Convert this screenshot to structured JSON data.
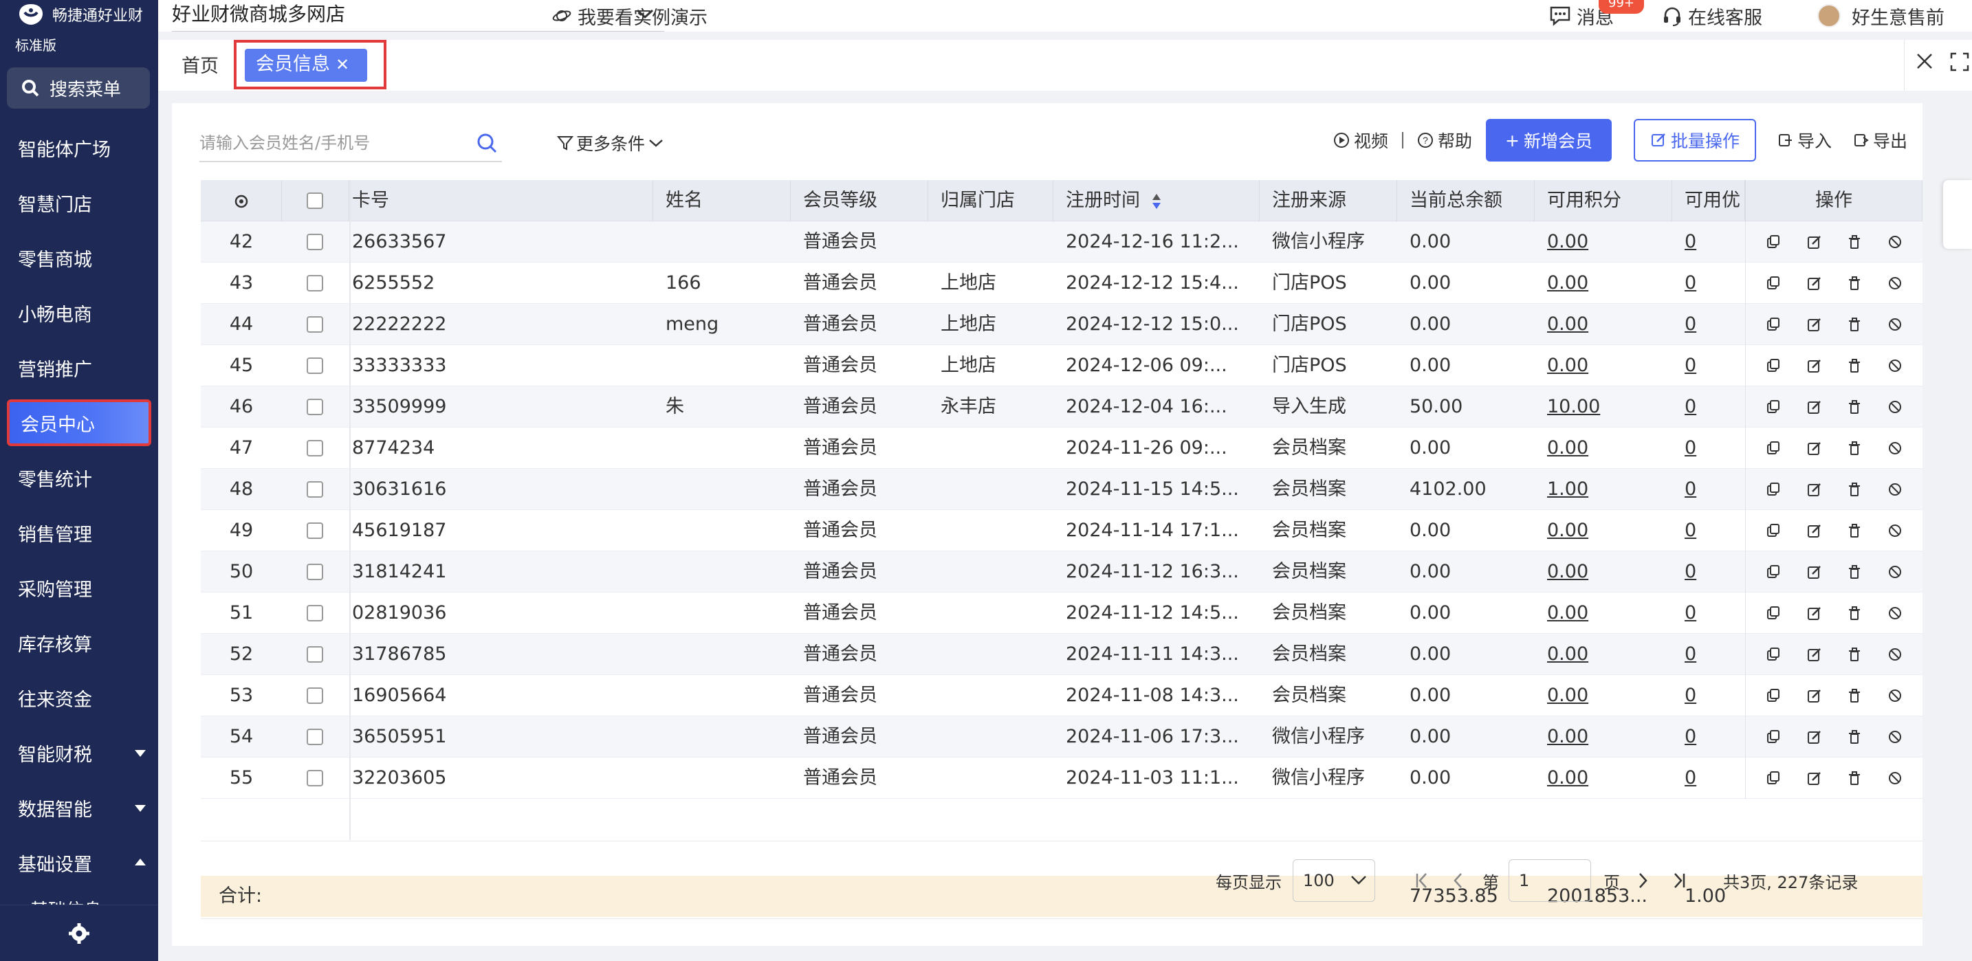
{
  "app": {
    "brand": "畅捷通好业财",
    "edition": "标准版",
    "search_menu": "搜索菜单"
  },
  "sidebar": {
    "items": [
      {
        "label": "智能体广场"
      },
      {
        "label": "智慧门店"
      },
      {
        "label": "零售商城"
      },
      {
        "label": "小畅电商"
      },
      {
        "label": "营销推广"
      },
      {
        "label": "会员中心",
        "active": true
      },
      {
        "label": "零售统计"
      },
      {
        "label": "销售管理"
      },
      {
        "label": "采购管理"
      },
      {
        "label": "库存核算"
      },
      {
        "label": "往来资金"
      },
      {
        "label": "智能财税",
        "arrow": "down"
      },
      {
        "label": "数据智能",
        "arrow": "down"
      },
      {
        "label": "基础设置",
        "arrow": "up"
      }
    ],
    "sub_item": "基础信息"
  },
  "topbar": {
    "store": "好业财微商城多网店",
    "demo": "我要看实例演示",
    "messages": "消息",
    "message_badge": "99+",
    "service": "在线客服",
    "user": "好生意售前"
  },
  "tabs": {
    "home": "首页",
    "active": "会员信息"
  },
  "filter": {
    "placeholder": "请输入会员姓名/手机号",
    "more": "更多条件"
  },
  "toolbar": {
    "video": "视频",
    "help": "帮助",
    "add": "新增会员",
    "batch": "批量操作",
    "import": "导入",
    "export": "导出"
  },
  "table": {
    "headers": {
      "card": "卡号",
      "name": "姓名",
      "level": "会员等级",
      "store": "归属门店",
      "reg_time": "注册时间",
      "source": "注册来源",
      "balance": "当前总余额",
      "points": "可用积分",
      "coupons": "可用优",
      "ops": "操作"
    },
    "rows": [
      {
        "idx": "42",
        "card": "26633567",
        "name": "",
        "level": "普通会员",
        "store": "",
        "time": "2024-12-16 11:2...",
        "source": "微信小程序",
        "balance": "0.00",
        "points": "0.00",
        "coupons": "0"
      },
      {
        "idx": "43",
        "card": "6255552",
        "name": "166",
        "level": "普通会员",
        "store": "上地店",
        "time": "2024-12-12 15:4...",
        "source": "门店POS",
        "balance": "0.00",
        "points": "0.00",
        "coupons": "0"
      },
      {
        "idx": "44",
        "card": "22222222",
        "name": "meng",
        "level": "普通会员",
        "store": "上地店",
        "time": "2024-12-12 15:0...",
        "source": "门店POS",
        "balance": "0.00",
        "points": "0.00",
        "coupons": "0"
      },
      {
        "idx": "45",
        "card": "33333333",
        "name": "",
        "level": "普通会员",
        "store": "上地店",
        "time": "2024-12-06 09:...",
        "source": "门店POS",
        "balance": "0.00",
        "points": "0.00",
        "coupons": "0"
      },
      {
        "idx": "46",
        "card": "33509999",
        "name": "朱",
        "level": "普通会员",
        "store": "永丰店",
        "time": "2024-12-04 16:...",
        "source": "导入生成",
        "balance": "50.00",
        "points": "10.00",
        "coupons": "0"
      },
      {
        "idx": "47",
        "card": "8774234",
        "name": "",
        "level": "普通会员",
        "store": "",
        "time": "2024-11-26 09:...",
        "source": "会员档案",
        "balance": "0.00",
        "points": "0.00",
        "coupons": "0"
      },
      {
        "idx": "48",
        "card": "30631616",
        "name": "",
        "level": "普通会员",
        "store": "",
        "time": "2024-11-15 14:5...",
        "source": "会员档案",
        "balance": "4102.00",
        "points": "1.00",
        "coupons": "0"
      },
      {
        "idx": "49",
        "card": "45619187",
        "name": "",
        "level": "普通会员",
        "store": "",
        "time": "2024-11-14 17:1...",
        "source": "会员档案",
        "balance": "0.00",
        "points": "0.00",
        "coupons": "0"
      },
      {
        "idx": "50",
        "card": "31814241",
        "name": "",
        "level": "普通会员",
        "store": "",
        "time": "2024-11-12 16:3...",
        "source": "会员档案",
        "balance": "0.00",
        "points": "0.00",
        "coupons": "0"
      },
      {
        "idx": "51",
        "card": "02819036",
        "name": "",
        "level": "普通会员",
        "store": "",
        "time": "2024-11-12 14:5...",
        "source": "会员档案",
        "balance": "0.00",
        "points": "0.00",
        "coupons": "0"
      },
      {
        "idx": "52",
        "card": "31786785",
        "name": "",
        "level": "普通会员",
        "store": "",
        "time": "2024-11-11 14:3...",
        "source": "会员档案",
        "balance": "0.00",
        "points": "0.00",
        "coupons": "0"
      },
      {
        "idx": "53",
        "card": "16905664",
        "name": "",
        "level": "普通会员",
        "store": "",
        "time": "2024-11-08 14:3...",
        "source": "会员档案",
        "balance": "0.00",
        "points": "0.00",
        "coupons": "0"
      },
      {
        "idx": "54",
        "card": "36505951",
        "name": "",
        "level": "普通会员",
        "store": "",
        "time": "2024-11-06 17:3...",
        "source": "微信小程序",
        "balance": "0.00",
        "points": "0.00",
        "coupons": "0"
      },
      {
        "idx": "55",
        "card": "32203605",
        "name": "",
        "level": "普通会员",
        "store": "",
        "time": "2024-11-03 11:1...",
        "source": "微信小程序",
        "balance": "0.00",
        "points": "0.00",
        "coupons": "0"
      }
    ],
    "summary": {
      "label": "合计:",
      "balance": "77353.85",
      "points": "2001853...",
      "coupons": "1.00"
    }
  },
  "pagination": {
    "per_page_label": "每页显示",
    "per_page": "100",
    "page_prefix": "第",
    "page": "1",
    "page_suffix": "页",
    "total": "共3页, 227条记录"
  },
  "colors": {
    "sidebar": "#1e2a55",
    "accent": "#4a68ef",
    "highlight_border": "#e23a3a",
    "summary_bg": "#fbf0dc"
  }
}
